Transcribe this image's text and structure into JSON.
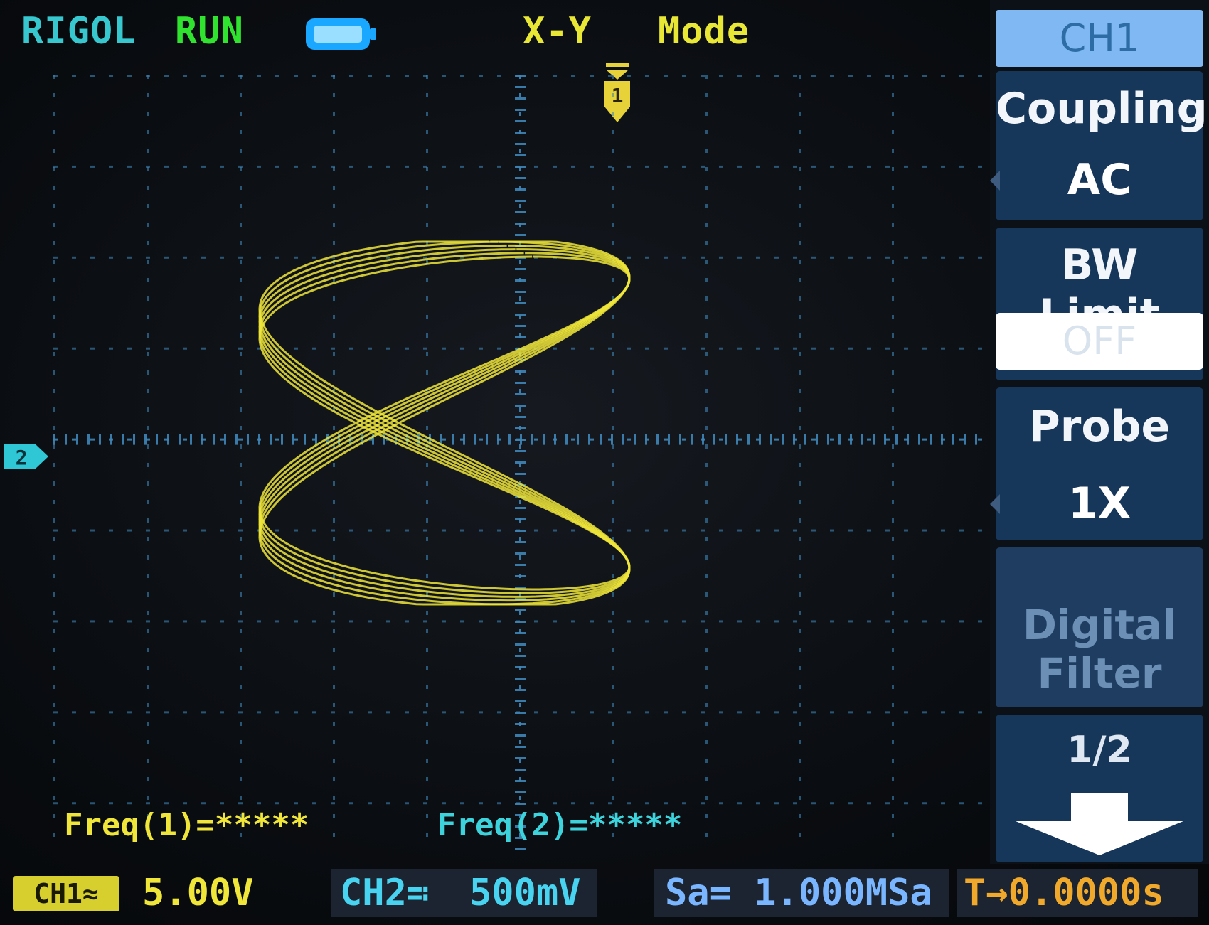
{
  "header": {
    "brand": "RIGOL",
    "run_status": "RUN",
    "mode_left": "X-Y",
    "mode_right": "Mode",
    "battery_icon": "battery-icon"
  },
  "measurements": {
    "freq1": "Freq(1)=*****",
    "freq2": "Freq(2)=*****"
  },
  "status_bar": {
    "ch1_badge": "CH1≈",
    "ch1_scale": "5.00V",
    "ch2_label": "CH2≕",
    "ch2_scale": "500mV",
    "sample_rate": "Sa= 1.000MSa",
    "time_offset": "T→0.0000s"
  },
  "menu": {
    "title": "CH1",
    "coupling_label": "Coupling",
    "coupling_value": "AC",
    "bw_label": "BW Limit",
    "bw_value": "OFF",
    "probe_label": "Probe",
    "probe_value": "1X",
    "filter_label": "Digital Filter",
    "page": "1/2"
  },
  "markers": {
    "trigger": "1",
    "ch2_ref": "2"
  },
  "colors": {
    "ch1": "#f0e63a",
    "ch2": "#3dd3dc",
    "grid": "#3f86b8",
    "menu_button": "#16365a"
  }
}
